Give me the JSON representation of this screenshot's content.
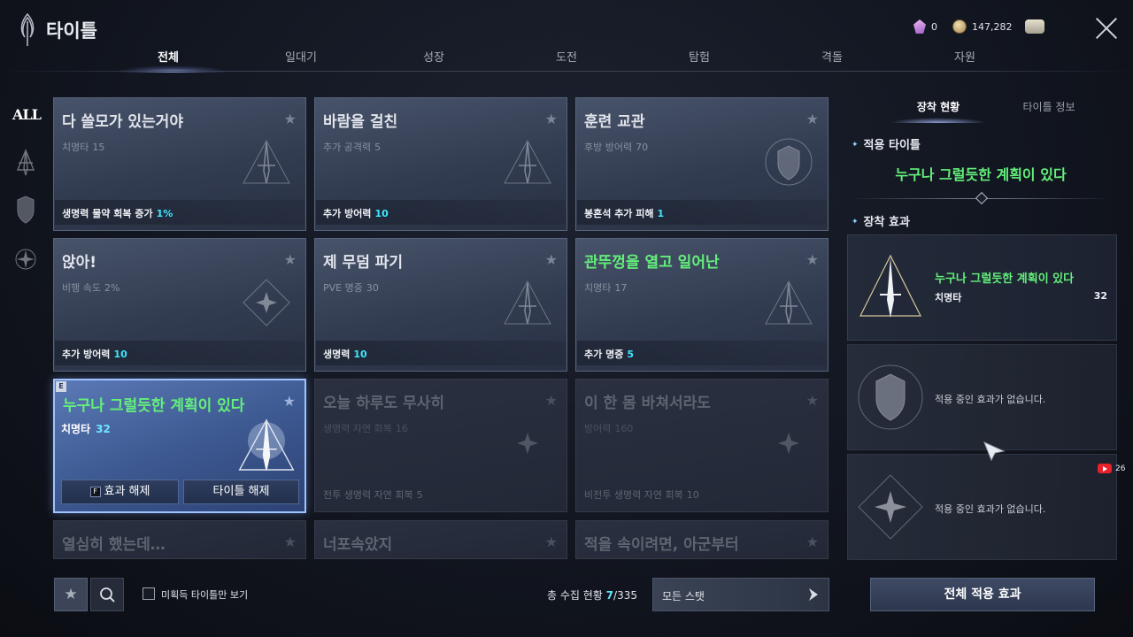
{
  "header": {
    "title": "타이틀",
    "currency_gem": "0",
    "currency_coin": "147,282",
    "icons": [
      "title-logo-icon",
      "gem-icon",
      "coin-icon",
      "scroll-icon",
      "close-icon"
    ]
  },
  "tabs": [
    {
      "label": "전체",
      "active": true
    },
    {
      "label": "일대기",
      "active": false
    },
    {
      "label": "성장",
      "active": false
    },
    {
      "label": "도전",
      "active": false
    },
    {
      "label": "탐험",
      "active": false
    },
    {
      "label": "격돌",
      "active": false
    },
    {
      "label": "자원",
      "active": false
    }
  ],
  "filters": {
    "all_label": "ALL",
    "icons": [
      "sword-filter-icon",
      "shield-filter-icon",
      "star-filter-icon"
    ]
  },
  "cards": [
    {
      "name": "다 쓸모가 있는거야",
      "stat": "치명타",
      "stat_val": "15",
      "bonus": "생명력 물약 회복 증가",
      "bonus_val": "1%",
      "emblem": "sword-emblem"
    },
    {
      "name": "바람을 걸친",
      "stat": "추가 공격력",
      "stat_val": "5",
      "bonus": "추가 방어력",
      "bonus_val": "10",
      "emblem": "sword-emblem"
    },
    {
      "name": "훈련 교관",
      "stat": "후방 방어력",
      "stat_val": "70",
      "bonus": "봉혼석 추가 피해",
      "bonus_val": "1",
      "emblem": "shield-emblem"
    },
    {
      "name": "앉아!",
      "stat": "비행 속도",
      "stat_val": "2%",
      "bonus": "추가 방어력",
      "bonus_val": "10",
      "emblem": "star-emblem"
    },
    {
      "name": "제 무덤 파기",
      "stat": "PVE 명중",
      "stat_val": "30",
      "bonus": "생명력",
      "bonus_val": "10",
      "emblem": "sword-emblem"
    },
    {
      "name": "관뚜껑을 열고 일어난",
      "stat": "치명타",
      "stat_val": "17",
      "bonus": "추가 명중",
      "bonus_val": "5",
      "emblem": "sword-emblem"
    },
    {
      "name": "누구나 그럴듯한 계획이 있다",
      "stat": "치명타",
      "stat_val": "32",
      "badge": "E",
      "btn_effect": "효과 해제",
      "btn_key": "F",
      "btn_title": "타이틀 해제"
    },
    {
      "name": "오늘 하루도 무사히",
      "stat": "생명력 자연 회복",
      "stat_val": "16",
      "bonus": "전투 생명력 자연 회복",
      "bonus_val": "5",
      "emblem": "star-emblem"
    },
    {
      "name": "이 한 몸 바쳐서라도",
      "stat": "방어력",
      "stat_val": "160",
      "bonus": "비전투 생명력 자연 회복",
      "bonus_val": "10",
      "emblem": "star-emblem"
    },
    {
      "name": "열심히 했는데…"
    },
    {
      "name": "너포속았지"
    },
    {
      "name": "적을 속이려면, 아군부터"
    }
  ],
  "bottom": {
    "unacquired_label": "미획득 타이틀만 보기",
    "collect_label": "총 수집 현황",
    "collect_count": "7",
    "collect_total": "/335",
    "stat_select": "모든 스탯"
  },
  "right_panel": {
    "tab_equip": "장착 현황",
    "tab_info": "타이틀 정보",
    "applied_title_label": "적용 타이틀",
    "applied_title": "누구나 그럴듯한 계획이 있다",
    "equip_effect_label": "장착 효과",
    "effects": [
      {
        "name": "누구나 그럴듯한 계획이 있다",
        "stat": "치명타",
        "value": "32"
      },
      {
        "empty": "적용 중인 효과가 없습니다."
      },
      {
        "empty": "적용 중인 효과가 없습니다."
      }
    ],
    "apply_all": "전체 적용 효과"
  },
  "overlay": {
    "yt_count": "26"
  },
  "colors": {
    "accent_green": "#63f07a",
    "accent_cyan": "#3fe6ff",
    "selected_border": "#9ec3ff"
  }
}
